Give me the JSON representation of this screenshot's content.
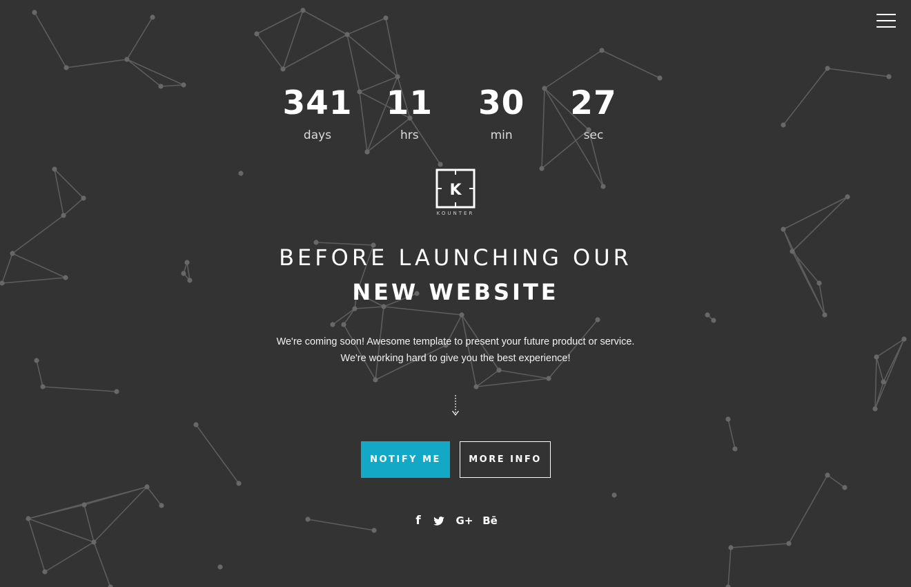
{
  "menu": {
    "icon": "hamburger-menu-icon"
  },
  "countdown": [
    {
      "value": "341",
      "label": "days"
    },
    {
      "value": "11",
      "label": "hrs"
    },
    {
      "value": "30",
      "label": "min"
    },
    {
      "value": "27",
      "label": "sec"
    }
  ],
  "logo": {
    "letter": "K",
    "name": "KOUNTER"
  },
  "headline": {
    "line1": "BEFORE LAUNCHING OUR",
    "line2": "NEW WEBSITE"
  },
  "tagline": [
    "We're coming soon! Awesome template to present your future product or service.",
    "We're working hard to give you the best experience!"
  ],
  "scroll": {
    "icon": "arrow-down-icon"
  },
  "buttons": {
    "notify": "NOTIFY ME",
    "more": "MORE INFO"
  },
  "social": [
    {
      "network": "facebook",
      "glyph": "f",
      "icon": "facebook-icon"
    },
    {
      "network": "twitter",
      "glyph": "",
      "icon": "twitter-icon"
    },
    {
      "network": "google-plus",
      "glyph": "G+",
      "icon": "google-plus-icon"
    },
    {
      "network": "behance",
      "glyph": "Bē",
      "icon": "behance-icon"
    }
  ],
  "colors": {
    "background": "#333333",
    "accent": "#13a8c6",
    "network": "#5d5d5d"
  }
}
